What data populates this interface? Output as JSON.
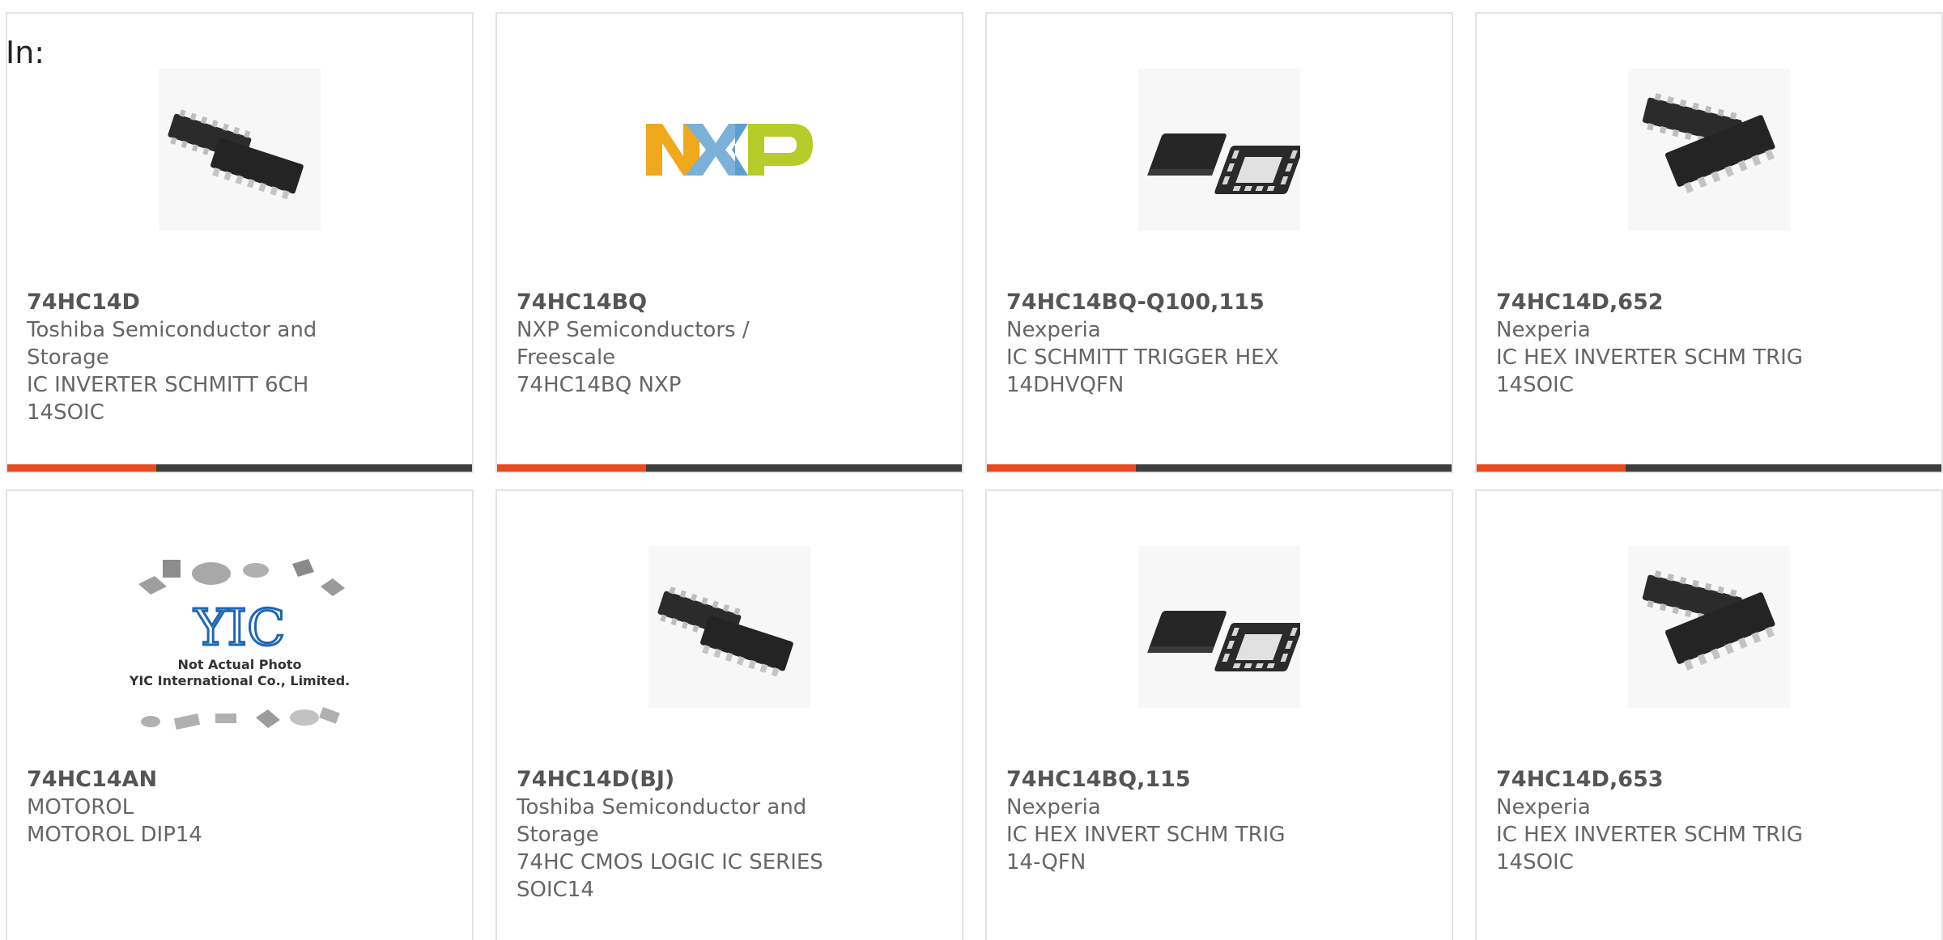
{
  "header": {
    "in_label": "In:"
  },
  "colors": {
    "accent": "#e84a1d",
    "bar": "#3d3d3d",
    "text": "#666666",
    "part": "#555555",
    "border": "#e3e3e3"
  },
  "products": [
    {
      "part": "74HC14D",
      "manufacturer": "Toshiba Semiconductor and Storage",
      "description": "IC INVERTER SCHMITT 6CH 14SOIC",
      "image": "soic-chip-pair-icon"
    },
    {
      "part": "74HC14BQ",
      "manufacturer": "NXP Semiconductors / Freescale",
      "description": "74HC14BQ NXP",
      "image": "nxp-logo"
    },
    {
      "part": "74HC14BQ-Q100,115",
      "manufacturer": "Nexperia",
      "description": "IC SCHMITT TRIGGER HEX 14DHVQFN",
      "image": "qfn-chip-pair-icon"
    },
    {
      "part": "74HC14D,652",
      "manufacturer": "Nexperia",
      "description": "IC HEX INVERTER SCHM TRIG 14SOIC",
      "image": "soic-chip-stack-icon"
    },
    {
      "part": "74HC14AN",
      "manufacturer": "MOTOROL",
      "description": "MOTOROL DIP14",
      "image": "not-actual-photo-placeholder",
      "placeholder_line1": "Not Actual Photo",
      "placeholder_line2": "YIC International Co., Limited."
    },
    {
      "part": "74HC14D(BJ)",
      "manufacturer": "Toshiba Semiconductor and Storage",
      "description": "74HC CMOS LOGIC IC SERIES SOIC14",
      "image": "soic-chip-pair-icon"
    },
    {
      "part": "74HC14BQ,115",
      "manufacturer": "Nexperia",
      "description": "IC HEX INVERT SCHM TRIG 14-QFN",
      "image": "qfn-chip-pair-icon"
    },
    {
      "part": "74HC14D,653",
      "manufacturer": "Nexperia",
      "description": "IC HEX INVERTER SCHM TRIG 14SOIC",
      "image": "soic-chip-stack-icon"
    }
  ]
}
